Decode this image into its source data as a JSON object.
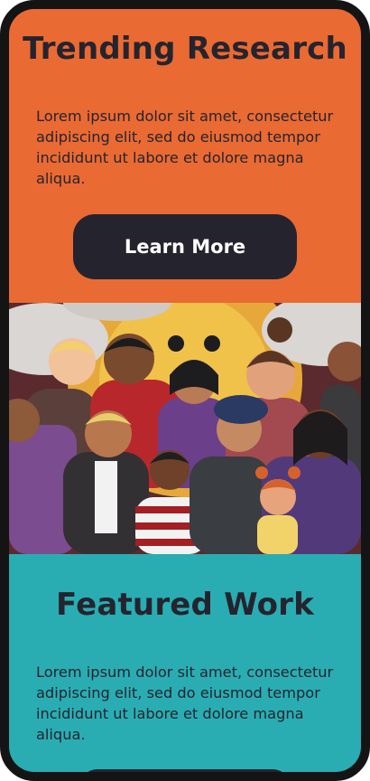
{
  "trending": {
    "title": "Trending Research",
    "body": "Lorem ipsum dolor sit amet, consectetur adipiscing elit, sed do eiusmod tempor incididunt ut labore et dolore magna aliqua.",
    "button_label": "Learn More"
  },
  "featured": {
    "title": "Featured Work",
    "body": "Lorem ipsum dolor sit amet, consectetur adipiscing elit, sed do eiusmod tempor incididunt ut labore et dolore magna aliqua."
  },
  "colors": {
    "orange": "#ea6a33",
    "teal": "#29adb3",
    "dark": "#25242e",
    "frame": "#141414"
  },
  "illustration": {
    "subject": "group-of-diverse-people-illustration"
  }
}
